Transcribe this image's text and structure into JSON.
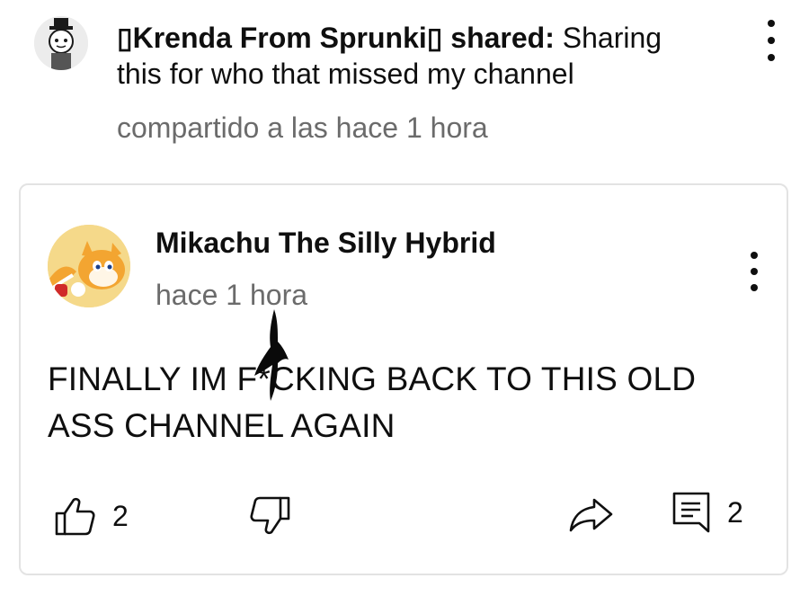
{
  "share_header": {
    "author": "▯Krenda From Sprunki▯",
    "shared_word": "shared:",
    "message": "Sharing this for who that missed my channel",
    "time": "compartido a las hace 1 hora",
    "avatar_icon": "character-avatar-icon",
    "menu_icon": "more-vertical-icon"
  },
  "comment": {
    "author": "Mikachu The Silly Hybrid",
    "time": "hace 1 hora",
    "body": "FINALLY IM F*CKING BACK TO THIS OLD ASS CHANNEL AGAIN",
    "avatar_icon": "fox-character-avatar-icon",
    "menu_icon": "more-vertical-icon",
    "actions": {
      "like_icon": "thumbs-up-icon",
      "like_count": "2",
      "dislike_icon": "thumbs-down-icon",
      "share_icon": "share-arrow-icon",
      "reply_icon": "comment-reply-icon",
      "reply_count": "2"
    }
  },
  "colors": {
    "text_primary": "#0f0f0f",
    "text_secondary": "#6b6b6b",
    "card_border": "#e3e3e3",
    "scribble": "#0a0a0a"
  }
}
